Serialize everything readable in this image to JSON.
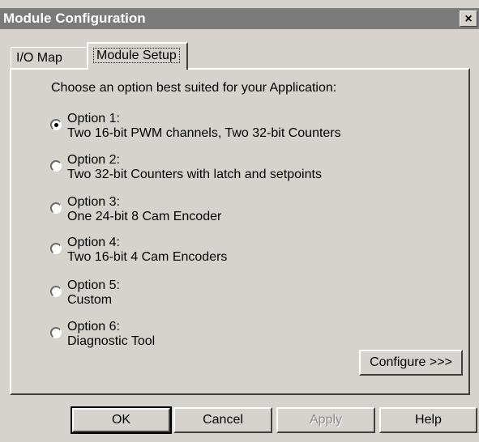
{
  "window": {
    "title": "Module Configuration",
    "close_label": "×"
  },
  "tabs": [
    {
      "label": "I/O Map",
      "active": false
    },
    {
      "label": "Module Setup",
      "active": true
    }
  ],
  "prompt": "Choose an option best suited for your Application:",
  "options": [
    {
      "name": "Option 1:",
      "desc": "Two 16-bit PWM channels, Two 32-bit Counters",
      "selected": true
    },
    {
      "name": "Option 2:",
      "desc": "Two 32-bit Counters with latch and setpoints",
      "selected": false
    },
    {
      "name": "Option 3:",
      "desc": "One 24-bit 8 Cam Encoder",
      "selected": false
    },
    {
      "name": "Option 4:",
      "desc": "Two 16-bit 4 Cam Encoders",
      "selected": false
    },
    {
      "name": "Option 5:",
      "desc": "Custom",
      "selected": false
    },
    {
      "name": "Option 6:",
      "desc": "Diagnostic Tool",
      "selected": false
    }
  ],
  "configure_label": "Configure >>>",
  "buttons": {
    "ok": "OK",
    "cancel": "Cancel",
    "apply": "Apply",
    "help": "Help"
  }
}
